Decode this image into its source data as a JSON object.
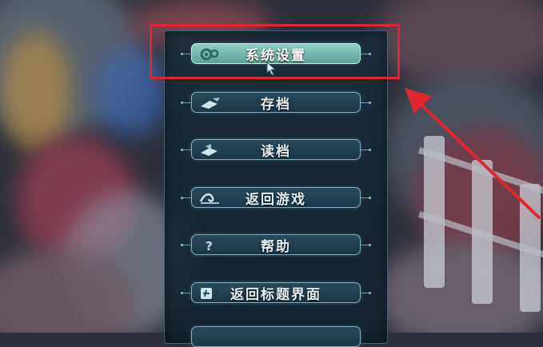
{
  "menu": {
    "items": [
      {
        "label": "系统设置",
        "icon": "gear-icon",
        "active": true
      },
      {
        "label": "存档",
        "icon": "save-icon",
        "active": false
      },
      {
        "label": "读档",
        "icon": "load-icon",
        "active": false
      },
      {
        "label": "返回游戏",
        "icon": "wave-icon",
        "active": false
      },
      {
        "label": "帮助",
        "icon": "question-icon",
        "active": false
      },
      {
        "label": "返回标题界面",
        "icon": "title-return-icon",
        "active": false
      }
    ]
  },
  "annotation": {
    "highlight_color": "#e0262e",
    "arrow_color": "#e0262e"
  },
  "colors": {
    "active_button": "#7cc6b9",
    "button_border": "#7fb0c0"
  }
}
